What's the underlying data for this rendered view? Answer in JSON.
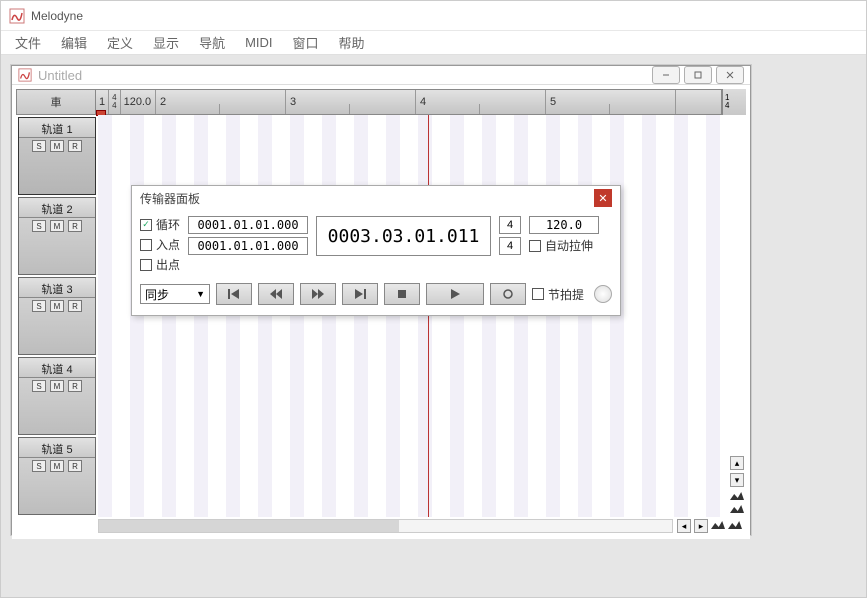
{
  "outer": {
    "title": "Melodyne"
  },
  "menu": {
    "items": [
      "文件",
      "编辑",
      "定义",
      "显示",
      "导航",
      "MIDI",
      "窗口",
      "帮助"
    ]
  },
  "inner": {
    "title": "Untitled"
  },
  "ruler": {
    "corner_char": "車",
    "start_num": "1",
    "sig_top": "4",
    "sig_bot": "4",
    "tempo": "120.0",
    "bars": [
      "2",
      "3",
      "4",
      "5"
    ],
    "end_top": "1",
    "end_bot": "4"
  },
  "tracks": [
    {
      "label": "轨道 1"
    },
    {
      "label": "轨道 2"
    },
    {
      "label": "轨道 3"
    },
    {
      "label": "轨道 4"
    },
    {
      "label": "轨道 5"
    }
  ],
  "smr": {
    "s": "S",
    "m": "M",
    "r": "R"
  },
  "transport": {
    "title": "传输器面板",
    "loop_label": "循环",
    "in_label": "入点",
    "out_label": "出点",
    "pos1": "0001.01.01.000",
    "pos2": "0001.01.01.000",
    "bigpos": "0003.03.01.011",
    "sig_top": "4",
    "sig_bot": "4",
    "tempo": "120.0",
    "autostretch_label": "自动拉伸",
    "sync_label": "同步",
    "metronome_label": "节拍提"
  }
}
